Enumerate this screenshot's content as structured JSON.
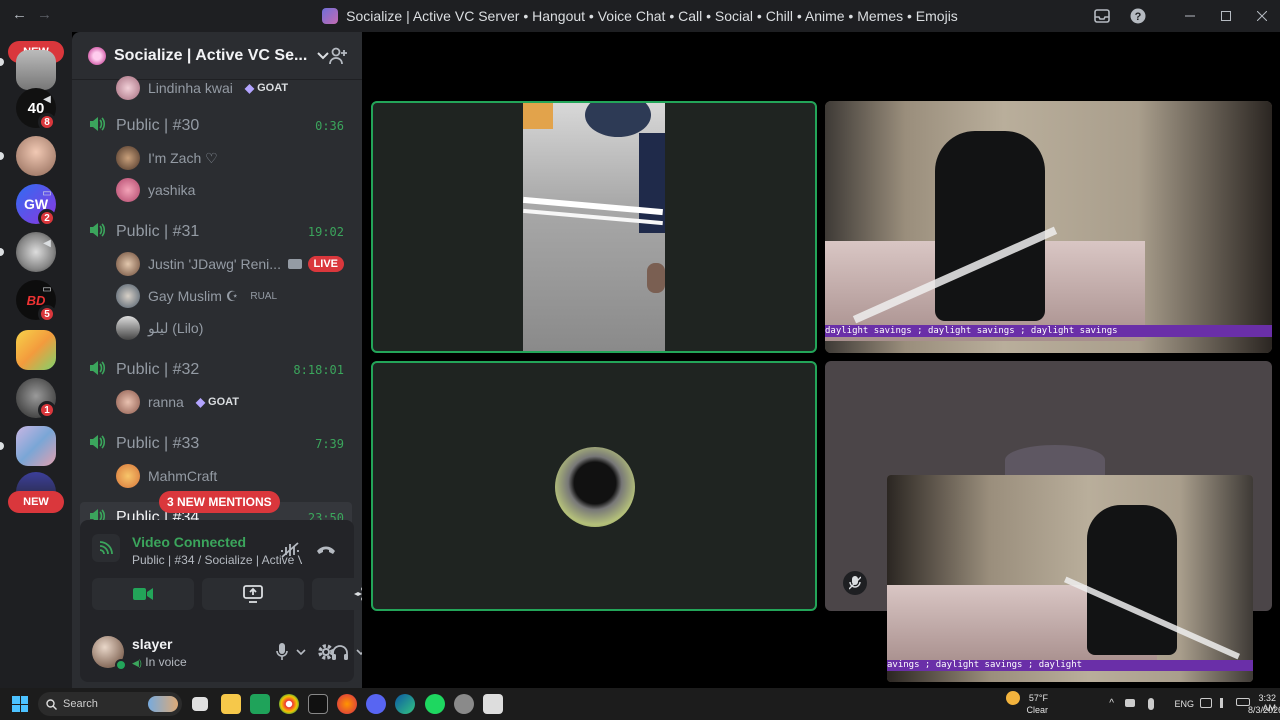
{
  "window": {
    "title": "Socialize | Active VC Server • Hangout • Voice Chat • Call • Social • Chill • Anime • Memes • Emojis",
    "back_arrow": "←",
    "forward_arrow": "→"
  },
  "rail": {
    "new_top_label": "NEW",
    "new_bottom_label": "NEW",
    "servers": [
      {
        "name": "server-1",
        "badge": ""
      },
      {
        "name": "server-40",
        "badge": "8"
      },
      {
        "name": "server-3",
        "badge": ""
      },
      {
        "name": "server-gw",
        "badge": "2"
      },
      {
        "name": "server-5",
        "badge": ""
      },
      {
        "name": "server-bd",
        "badge": "5"
      },
      {
        "name": "server-7",
        "badge": ""
      },
      {
        "name": "server-8",
        "badge": "1"
      },
      {
        "name": "server-9",
        "badge": ""
      }
    ]
  },
  "server": {
    "name": "Socialize | Active VC Se..."
  },
  "channels": [
    {
      "name": "Public | #30",
      "timer": "0:36"
    },
    {
      "name": "Public | #31",
      "timer": "19:02"
    },
    {
      "name": "Public | #32",
      "timer": "8:18:01"
    },
    {
      "name": "Public | #33",
      "timer": "7:39"
    },
    {
      "name": "Public | #34",
      "timer": "23:50"
    }
  ],
  "users": {
    "top": {
      "name": "Lindinha kwai",
      "tag": "GOAT"
    },
    "c30": [
      {
        "name": "I'm Zach ♡"
      },
      {
        "name": "yashika"
      }
    ],
    "c31": [
      {
        "name": "Justin 'JDawg' Reni..."
      },
      {
        "name": "Gay Muslim ☪",
        "tag": "RUAL"
      },
      {
        "name": "لیلو (Lilo)"
      }
    ],
    "c32": [
      {
        "name": "ranna",
        "tag": "GOAT"
      }
    ],
    "c33": [
      {
        "name": "MahmCraft"
      }
    ]
  },
  "live_label": "LIVE",
  "mentions_label": "3 NEW MENTIONS",
  "voice": {
    "title": "Video Connected",
    "subtitle": "Public | #34 / Socialize | Active VC Se..."
  },
  "me": {
    "name": "slayer",
    "status": "In voice"
  },
  "stage": {
    "overlay_text_top": "daylight savings ;   daylight savings ;   daylight savings",
    "overlay_text_bottom": "avings ;      daylight savings ;      daylight"
  },
  "taskbar": {
    "search_placeholder": "Search",
    "weather_temp": "57°F",
    "weather_desc": "Clear",
    "lang": "ENG",
    "time": "3:32 AM",
    "date": "8/3/2026"
  },
  "colors": {
    "speaking": "#23a559",
    "accent_red": "#da373c",
    "voice_green": "#3ba55c"
  }
}
